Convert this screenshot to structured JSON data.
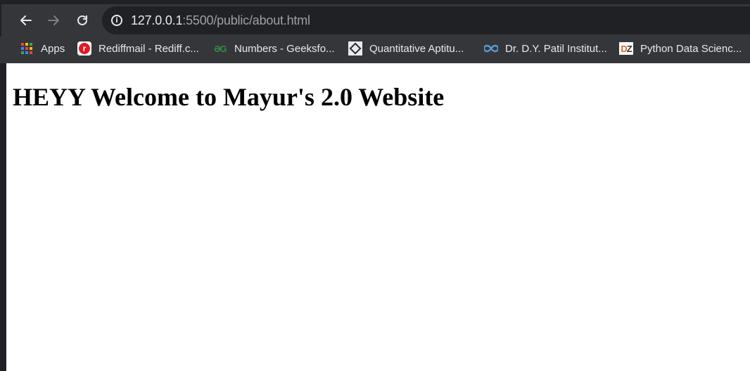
{
  "browser": {
    "url_host": "127.0.0.1",
    "url_rest": ":5500/public/about.html",
    "nav": {
      "back_icon": "arrow-left-icon",
      "forward_icon": "arrow-right-icon",
      "reload_icon": "reload-icon",
      "info_icon": "info-icon"
    }
  },
  "bookmarks": [
    {
      "label": "Apps",
      "icon": "apps-grid-icon"
    },
    {
      "label": "Rediffmail - Rediff.c...",
      "icon": "rediff-icon"
    },
    {
      "label": "Numbers - Geeksfo...",
      "icon": "geeksforgeeks-icon"
    },
    {
      "label": "Quantitative Aptitu...",
      "icon": "quant-icon"
    },
    {
      "label": "Dr. D.Y. Patil Institut...",
      "icon": "infinity-icon"
    },
    {
      "label": "Python Data Scienc...",
      "icon": "dzone-icon"
    }
  ],
  "page": {
    "heading": "HEYY Welcome to Mayur's 2.0 Website"
  },
  "colors": {
    "toolbar": "#35363a",
    "omnibox": "#202124",
    "page_bg": "#ffffff"
  }
}
